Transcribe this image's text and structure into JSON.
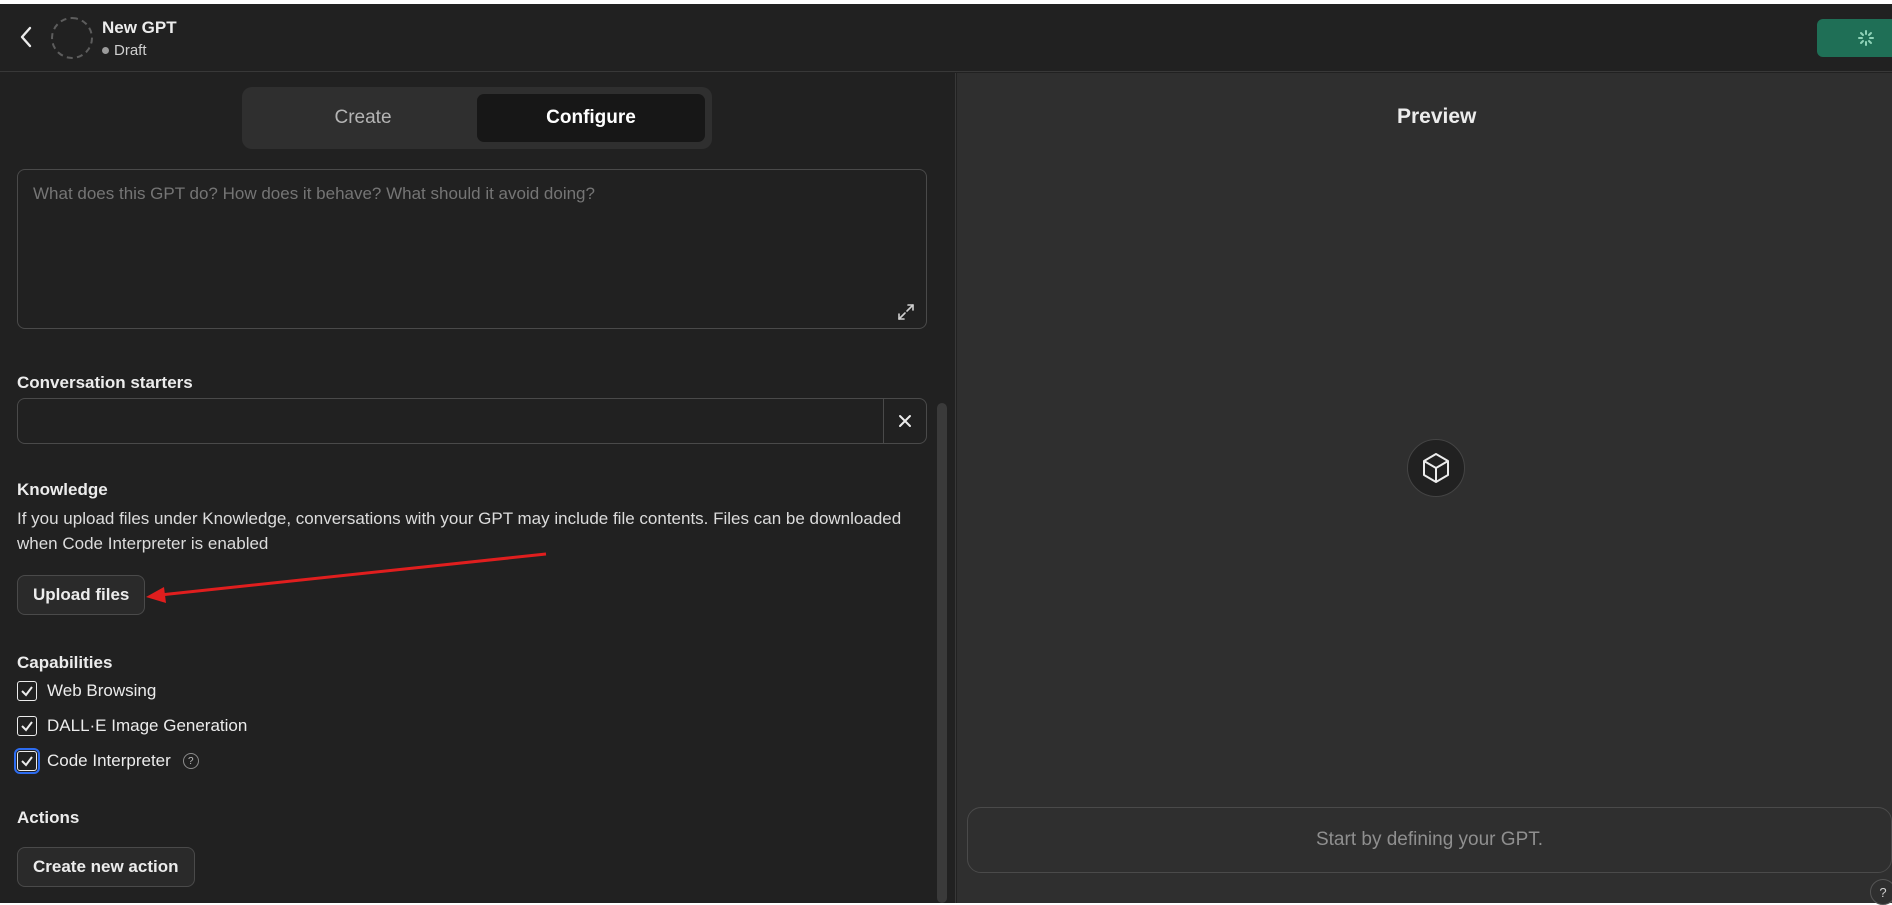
{
  "header": {
    "name": "New GPT",
    "status": "Draft",
    "accent_color": "#1f6f56"
  },
  "tabs": [
    {
      "label": "Create",
      "active": false
    },
    {
      "label": "Configure",
      "active": true
    }
  ],
  "instructions": {
    "placeholder": "What does this GPT do? How does it behave? What should it avoid doing?",
    "value": ""
  },
  "conversation_starters": {
    "label": "Conversation starters",
    "value": ""
  },
  "knowledge": {
    "label": "Knowledge",
    "description": "If you upload files under Knowledge, conversations with your GPT may include file contents. Files can be downloaded when Code Interpreter is enabled",
    "upload_label": "Upload files"
  },
  "capabilities": {
    "label": "Capabilities",
    "items": [
      {
        "label": "Web Browsing",
        "checked": true
      },
      {
        "label": "DALL·E Image Generation",
        "checked": true
      },
      {
        "label": "Code Interpreter",
        "checked": true,
        "help": "?"
      }
    ]
  },
  "actions": {
    "label": "Actions",
    "create_label": "Create new action"
  },
  "preview": {
    "title": "Preview",
    "input_placeholder": "Start by defining your GPT.",
    "help": "?"
  },
  "icons": {
    "back": "chevron-left-icon",
    "expand": "expand-icon",
    "clear": "close-icon",
    "cube": "cube-icon",
    "spinner": "spinner-icon",
    "annotation_arrow": "red-arrow"
  }
}
